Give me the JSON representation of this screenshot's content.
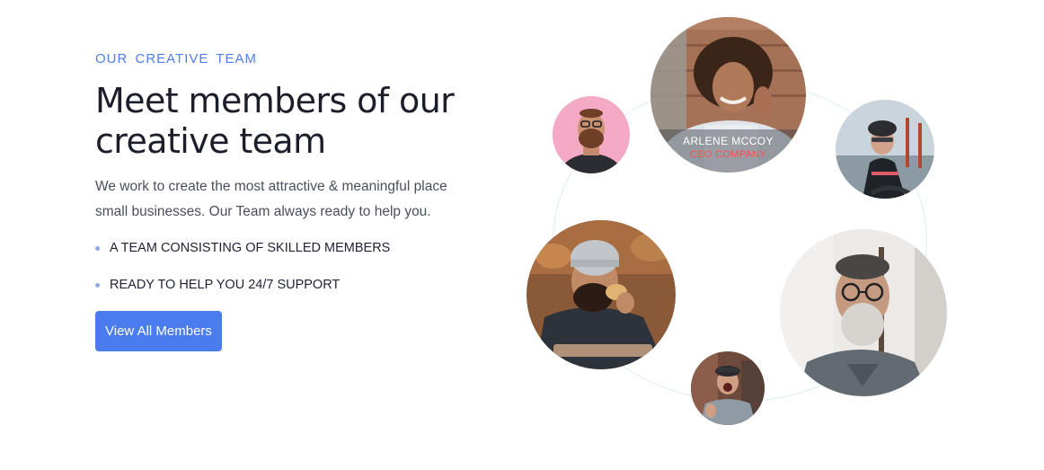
{
  "section": {
    "eyebrow": "OUR CREATIVE TEAM",
    "title_line1": "Meet members of our",
    "title_line2": "creative team",
    "description_line1": "We work to create the most attractive & meaningful place",
    "description_line2": "small businesses. Our Team always ready to help you.",
    "features": [
      "A TEAM CONSISTING OF SKILLED MEMBERS",
      "READY TO HELP YOU 24/7 SUPPORT"
    ],
    "cta_label": "View All Members"
  },
  "featured_member": {
    "name": "ARLENE MCCOY",
    "role": "CEO COMPANY"
  },
  "colors": {
    "accent": "#4a7cf0",
    "heading": "#1c1f2b",
    "role_text": "#ff4d4d"
  }
}
